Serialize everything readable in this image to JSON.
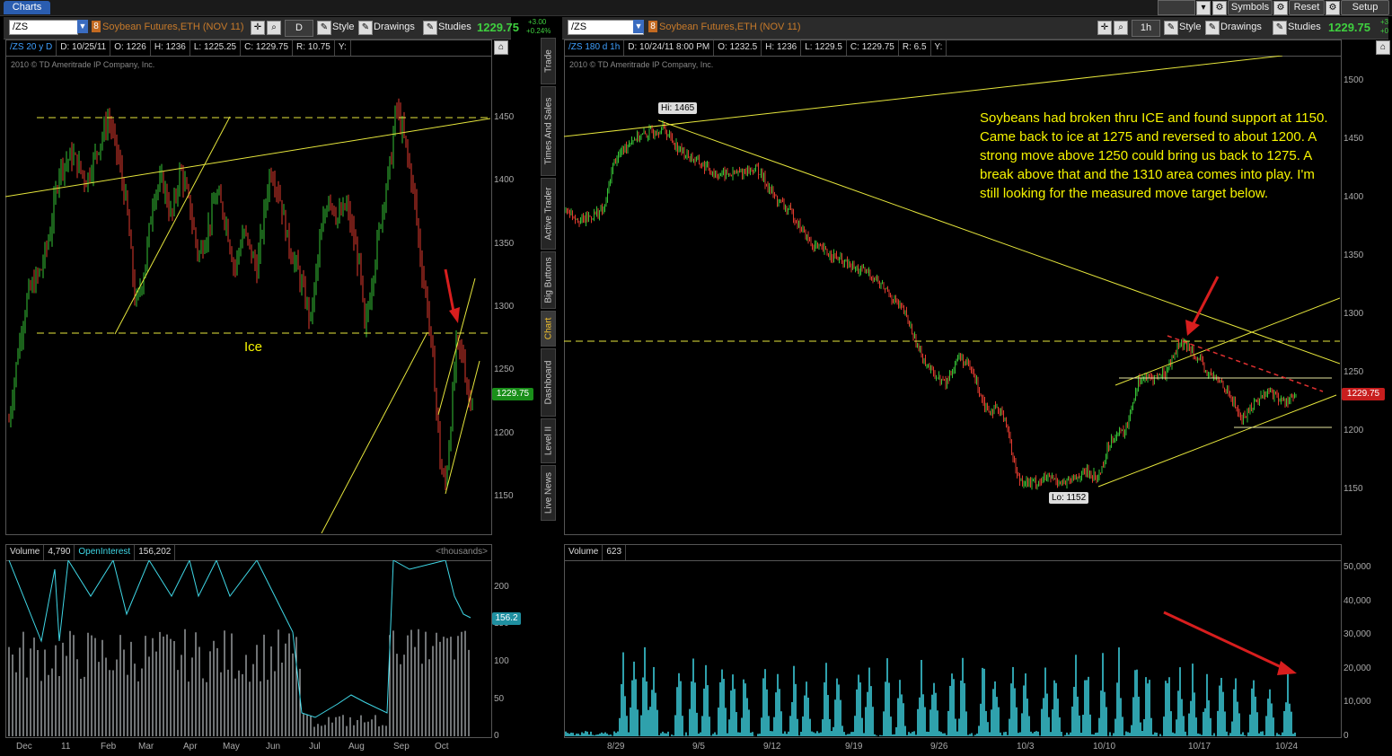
{
  "app": {
    "tab": "Charts"
  },
  "top_buttons": {
    "symbols": "Symbols",
    "reset": "Reset",
    "setup": "Setup"
  },
  "left": {
    "symbol": "/ZS",
    "badge": "8",
    "description": "Soybean Futures,ETH (NOV 11)",
    "period": "D",
    "style": "Style",
    "drawings": "Drawings",
    "studies": "Studies",
    "last": "1229.75",
    "chg1": "+3.00",
    "chg2": "+0.24%",
    "info": [
      "/ZS 20 y D",
      "D: 10/25/11",
      "O: 1226",
      "H: 1236",
      "L: 1225.25",
      "C: 1229.75",
      "R: 10.75",
      "Y:"
    ],
    "copyright": "2010 © TD Ameritrade IP Company, Inc.",
    "ice_label": "Ice",
    "price_axis": [
      "1450",
      "1400",
      "1350",
      "1300",
      "1250",
      "1200",
      "1150"
    ],
    "price_tag": "1229.75",
    "vol_info": [
      "Volume",
      "4,790",
      "OpenInterest",
      "156,202"
    ],
    "thousands": "<thousands>",
    "vol_axis": [
      "200",
      "150",
      "100",
      "50",
      "0"
    ],
    "oi_tag": "156.2",
    "x_axis": [
      "Dec",
      "11",
      "Feb",
      "Mar",
      "Apr",
      "May",
      "Jun",
      "Jul",
      "Aug",
      "Sep",
      "Oct"
    ]
  },
  "side_tabs": [
    "Trade",
    "Times And Sales",
    "Active Trader",
    "Big Buttons",
    "Chart",
    "Dashboard",
    "Level II",
    "Live News"
  ],
  "right": {
    "symbol": "/ZS",
    "badge": "8",
    "description": "Soybean Futures,ETH (NOV 11)",
    "period": "1h",
    "style": "Style",
    "drawings": "Drawings",
    "studies": "Studies",
    "last": "1229.75",
    "chg1": "+3",
    "chg2": "+0",
    "info": [
      "/ZS 180 d 1h",
      "D: 10/24/11 8:00 PM",
      "O: 1232.5",
      "H: 1236",
      "L: 1229.5",
      "C: 1229.75",
      "R: 6.5",
      "Y:"
    ],
    "copyright": "2010 © TD Ameritrade IP Company, Inc.",
    "hi_label": "Hi: 1465",
    "lo_label": "Lo: 1152",
    "note": "Soybeans had broken thru ICE and found support at 1150.  Came back to ice at 1275 and reversed to about 1200.  A strong move above 1250 could bring us back to 1275.  A break above that and the 1310 area comes into play.  I'm still looking for the measured move target below.",
    "price_axis": [
      "1500",
      "1450",
      "1400",
      "1350",
      "1300",
      "1250",
      "1200",
      "1150"
    ],
    "price_tag": "1229.75",
    "vol_info": [
      "Volume",
      "623"
    ],
    "vol_axis": [
      "50,000",
      "40,000",
      "30,000",
      "20,000",
      "10,000",
      "0"
    ],
    "x_axis": [
      "8/29",
      "9/5",
      "9/12",
      "9/19",
      "9/26",
      "10/3",
      "10/10",
      "10/17",
      "10/24"
    ]
  },
  "colors": {
    "up": "#36c236",
    "down": "#e03a2e",
    "trend": "#e6e63c",
    "volume": "#3fd7e6",
    "arrow": "#d81e1e"
  }
}
